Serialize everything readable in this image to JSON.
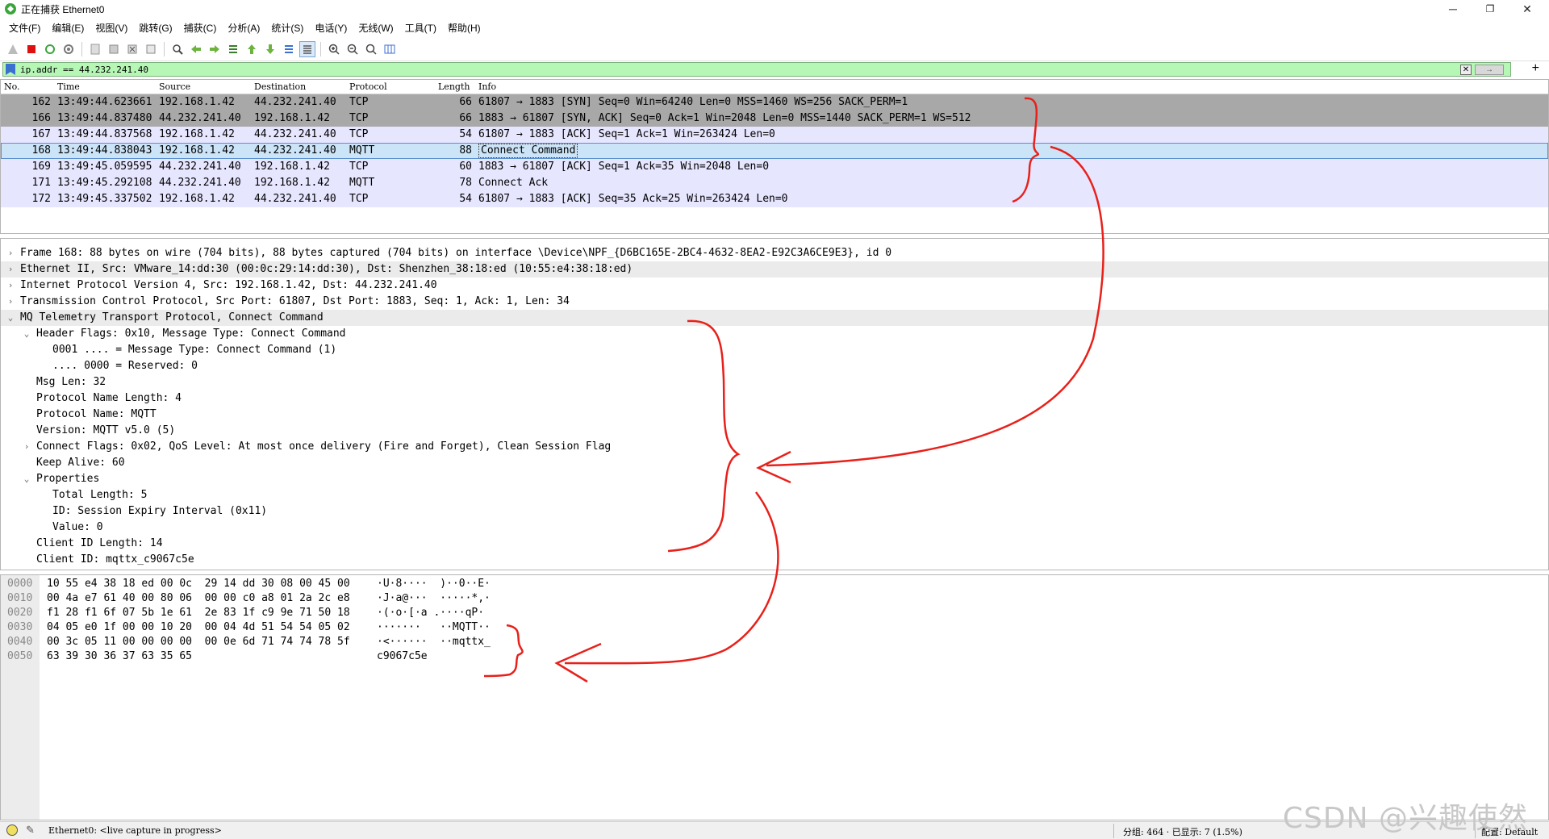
{
  "window": {
    "title": "正在捕获 Ethernet0",
    "minimize": "─",
    "restore": "❐",
    "close": "✕"
  },
  "menu": [
    "文件(F)",
    "编辑(E)",
    "视图(V)",
    "跳转(G)",
    "捕获(C)",
    "分析(A)",
    "统计(S)",
    "电话(Y)",
    "无线(W)",
    "工具(T)",
    "帮助(H)"
  ],
  "filter": {
    "value": "ip.addr == 44.232.241.40",
    "add": "+",
    "clear": "✕",
    "apply": "→"
  },
  "packet_columns": {
    "no": "No.",
    "time": "Time",
    "source": "Source",
    "destination": "Destination",
    "protocol": "Protocol",
    "length": "Length",
    "info": "Info"
  },
  "packets": [
    {
      "no": "162",
      "time": "13:49:44.623661",
      "src": "192.168.1.42",
      "dst": "44.232.241.40",
      "proto": "TCP",
      "len": "66",
      "info": "61807 → 1883 [SYN] Seq=0 Win=64240 Len=0 MSS=1460 WS=256 SACK_PERM=1",
      "bg": "#a8a8a8"
    },
    {
      "no": "166",
      "time": "13:49:44.837480",
      "src": "44.232.241.40",
      "dst": "192.168.1.42",
      "proto": "TCP",
      "len": "66",
      "info": "1883 → 61807 [SYN, ACK] Seq=0 Ack=1 Win=2048 Len=0 MSS=1440 SACK_PERM=1 WS=512",
      "bg": "#a8a8a8"
    },
    {
      "no": "167",
      "time": "13:49:44.837568",
      "src": "192.168.1.42",
      "dst": "44.232.241.40",
      "proto": "TCP",
      "len": "54",
      "info": "61807 → 1883 [ACK] Seq=1 Ack=1 Win=263424 Len=0",
      "bg": "#e7e6ff"
    },
    {
      "no": "168",
      "time": "13:49:44.838043",
      "src": "192.168.1.42",
      "dst": "44.232.241.40",
      "proto": "MQTT",
      "len": "88",
      "info": "Connect Command",
      "bg": "#cce4f7"
    },
    {
      "no": "169",
      "time": "13:49:45.059595",
      "src": "44.232.241.40",
      "dst": "192.168.1.42",
      "proto": "TCP",
      "len": "60",
      "info": "1883 → 61807 [ACK] Seq=1 Ack=35 Win=2048 Len=0",
      "bg": "#e7e6ff"
    },
    {
      "no": "171",
      "time": "13:49:45.292108",
      "src": "44.232.241.40",
      "dst": "192.168.1.42",
      "proto": "MQTT",
      "len": "78",
      "info": "Connect Ack",
      "bg": "#e7e6ff"
    },
    {
      "no": "172",
      "time": "13:49:45.337502",
      "src": "192.168.1.42",
      "dst": "44.232.241.40",
      "proto": "TCP",
      "len": "54",
      "info": "61807 → 1883 [ACK] Seq=35 Ack=25 Win=263424 Len=0",
      "bg": "#e7e6ff"
    }
  ],
  "details": [
    {
      "indent": 0,
      "arrow": "›",
      "text": "Frame 168: 88 bytes on wire (704 bits), 88 bytes captured (704 bits) on interface \\Device\\NPF_{D6BC165E-2BC4-4632-8EA2-E92C3A6CE9E3}, id 0",
      "bg": "#ffffff"
    },
    {
      "indent": 0,
      "arrow": "›",
      "text": "Ethernet II, Src: VMware_14:dd:30 (00:0c:29:14:dd:30), Dst: Shenzhen_38:18:ed (10:55:e4:38:18:ed)",
      "bg": "#ebebeb"
    },
    {
      "indent": 0,
      "arrow": "›",
      "text": "Internet Protocol Version 4, Src: 192.168.1.42, Dst: 44.232.241.40",
      "bg": "#ffffff"
    },
    {
      "indent": 0,
      "arrow": "›",
      "text": "Transmission Control Protocol, Src Port: 61807, Dst Port: 1883, Seq: 1, Ack: 1, Len: 34",
      "bg": "#ffffff"
    },
    {
      "indent": 0,
      "arrow": "⌄",
      "text": "MQ Telemetry Transport Protocol, Connect Command",
      "bg": "#ebebeb"
    },
    {
      "indent": 1,
      "arrow": "⌄",
      "text": "Header Flags: 0x10, Message Type: Connect Command",
      "bg": "#ffffff"
    },
    {
      "indent": 2,
      "arrow": "",
      "text": "0001 .... = Message Type: Connect Command (1)",
      "bg": "#ffffff"
    },
    {
      "indent": 2,
      "arrow": "",
      "text": ".... 0000 = Reserved: 0",
      "bg": "#ffffff"
    },
    {
      "indent": 1,
      "arrow": "",
      "text": "Msg Len: 32",
      "bg": "#ffffff"
    },
    {
      "indent": 1,
      "arrow": "",
      "text": "Protocol Name Length: 4",
      "bg": "#ffffff"
    },
    {
      "indent": 1,
      "arrow": "",
      "text": "Protocol Name: MQTT",
      "bg": "#ffffff"
    },
    {
      "indent": 1,
      "arrow": "",
      "text": "Version: MQTT v5.0 (5)",
      "bg": "#ffffff"
    },
    {
      "indent": 1,
      "arrow": "›",
      "text": "Connect Flags: 0x02, QoS Level: At most once delivery (Fire and Forget), Clean Session Flag",
      "bg": "#ffffff"
    },
    {
      "indent": 1,
      "arrow": "",
      "text": "Keep Alive: 60",
      "bg": "#ffffff"
    },
    {
      "indent": 1,
      "arrow": "⌄",
      "text": "Properties",
      "bg": "#ffffff"
    },
    {
      "indent": 2,
      "arrow": "",
      "text": "Total Length: 5",
      "bg": "#ffffff"
    },
    {
      "indent": 2,
      "arrow": "",
      "text": "ID: Session Expiry Interval (0x11)",
      "bg": "#ffffff"
    },
    {
      "indent": 2,
      "arrow": "",
      "text": "Value: 0",
      "bg": "#ffffff"
    },
    {
      "indent": 1,
      "arrow": "",
      "text": "Client ID Length: 14",
      "bg": "#ffffff"
    },
    {
      "indent": 1,
      "arrow": "",
      "text": "Client ID: mqttx_c9067c5e",
      "bg": "#ffffff"
    }
  ],
  "bytes": [
    {
      "offset": "0000",
      "hex": "10 55 e4 38 18 ed 00 0c  29 14 dd 30 08 00 45 00",
      "ascii": "·U·8····  )··0··E·"
    },
    {
      "offset": "0010",
      "hex": "00 4a e7 61 40 00 80 06  00 00 c0 a8 01 2a 2c e8",
      "ascii": "·J·a@···  ·····*,·"
    },
    {
      "offset": "0020",
      "hex": "f1 28 f1 6f 07 5b 1e 61  2e 83 1f c9 9e 71 50 18",
      "ascii": "·(·o·[·a .····qP·"
    },
    {
      "offset": "0030",
      "hex": "04 05 e0 1f 00 00 10 20  00 04 4d 51 54 54 05 02",
      "ascii": "·······   ··MQTT··"
    },
    {
      "offset": "0040",
      "hex": "00 3c 05 11 00 00 00 00  00 0e 6d 71 74 74 78 5f",
      "ascii": "·<······  ··mqttx_"
    },
    {
      "offset": "0050",
      "hex": "63 39 30 36 37 63 35 65",
      "ascii": "c9067c5e"
    }
  ],
  "status": {
    "capture": "Ethernet0: <live capture in progress>",
    "counts": "分组: 464 · 已显示: 7 (1.5%)",
    "profile": "配置: Default"
  },
  "watermark": "CSDN @兴趣使然",
  "colors": {
    "annotation": "#e8201a",
    "filter_bg": "#b6f7b6",
    "selected_row": "#cce4f7"
  }
}
